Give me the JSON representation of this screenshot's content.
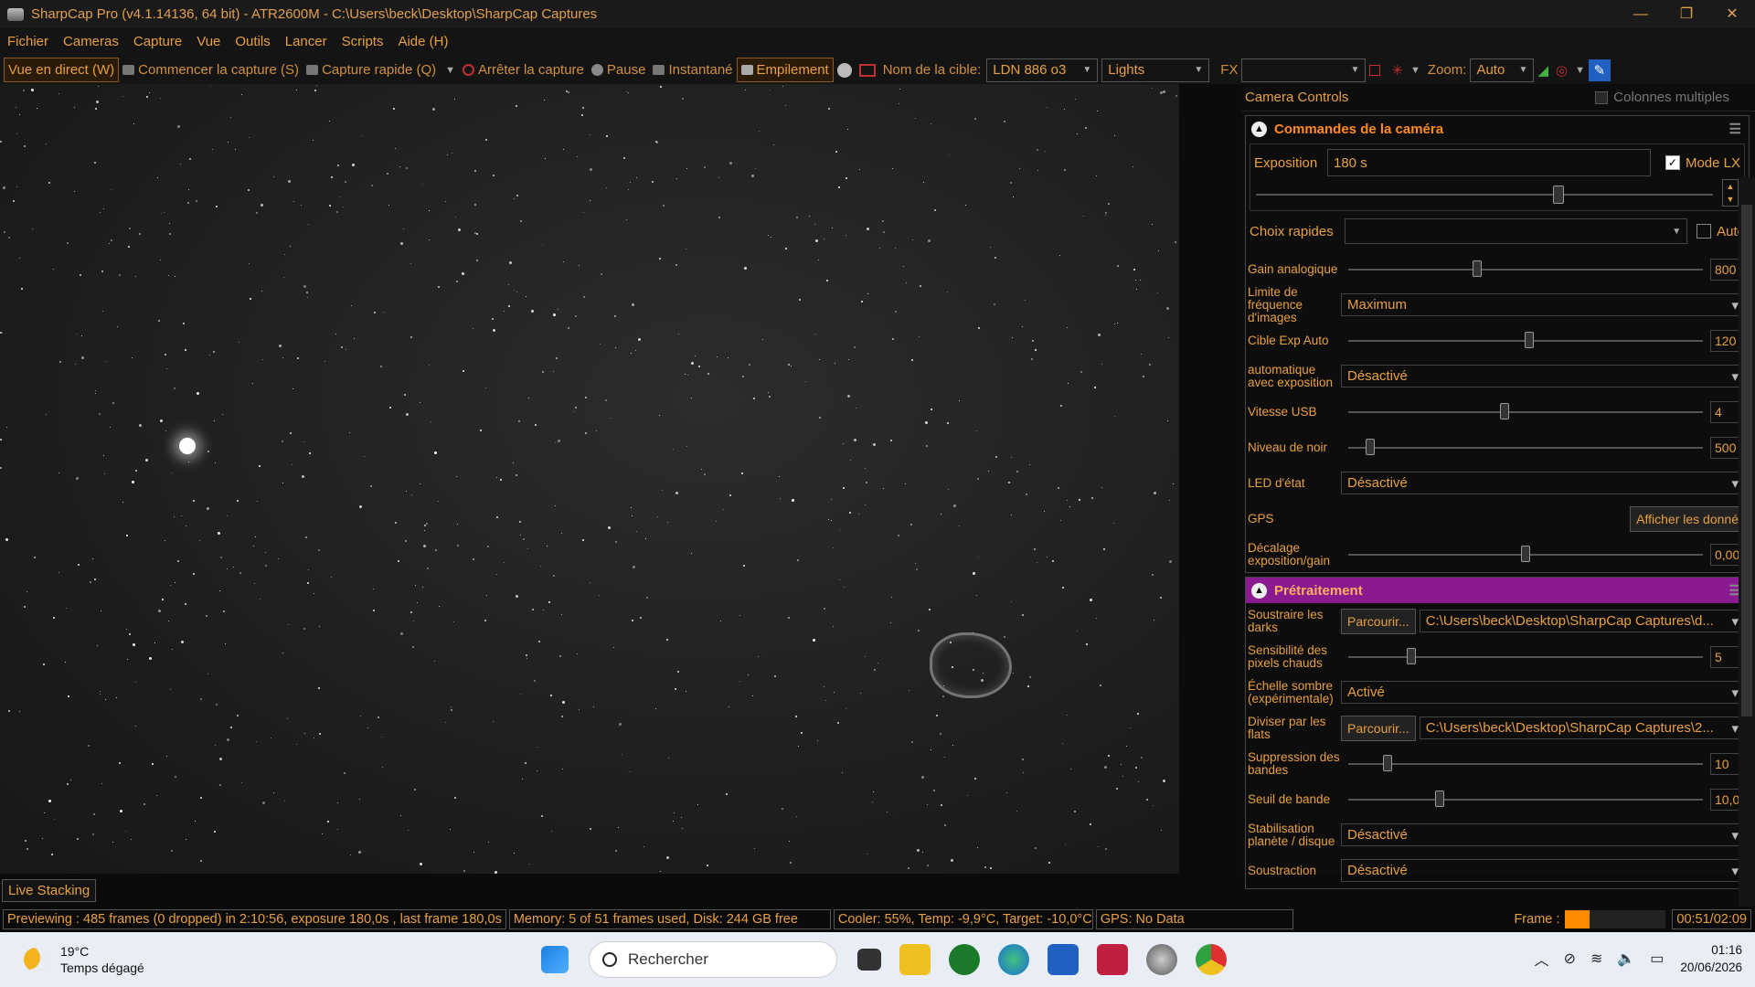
{
  "window": {
    "title": "SharpCap Pro (v4.1.14136, 64 bit) - ATR2600M - C:\\Users\\beck\\Desktop\\SharpCap Captures",
    "minimize": "—",
    "maximize": "❐",
    "close": "✕"
  },
  "menu": [
    "Fichier",
    "Cameras",
    "Capture",
    "Vue",
    "Outils",
    "Lancer",
    "Scripts",
    "Aide (H)"
  ],
  "toolbar": {
    "live_view": "Vue en direct (W)",
    "start_capture": "Commencer la capture (S)",
    "quick_capture": "Capture rapide (Q)",
    "stop_capture": "Arrêter la capture",
    "pause": "Pause",
    "snapshot": "Instantané",
    "stacking": "Empilement",
    "target_label": "Nom de la cible:",
    "target_value": "LDN 886 o3",
    "frame_type": "Lights",
    "fx_label": "FX",
    "fx_value": "",
    "zoom_label": "Zoom:",
    "zoom_value": "Auto"
  },
  "panel": {
    "title": "Camera Controls",
    "multi_columns": "Colonnes multiples",
    "camera_section": {
      "title": "Commandes de la caméra",
      "exposure_label": "Exposition",
      "exposure_value": "180 s",
      "lx_mode": "Mode LX",
      "quick_choice": "Choix rapides",
      "auto": "Auto",
      "rows": [
        {
          "label": "Gain analogique",
          "value": "800",
          "level": 0.36
        },
        {
          "label": "Limite de fréquence d'images",
          "select": "Maximum"
        },
        {
          "label": "Cible Exp Auto",
          "value": "120",
          "level": 0.51
        },
        {
          "label": "automatique avec exposition",
          "select": "Désactivé"
        },
        {
          "label": "Vitesse USB",
          "value": "4",
          "level": 0.44
        },
        {
          "label": "Niveau de noir",
          "value": "500",
          "level": 0.05
        },
        {
          "label": "LED d'état",
          "select": "Désactivé"
        },
        {
          "label": "GPS",
          "button": "Afficher les donné"
        },
        {
          "label": "Décalage exposition/gain",
          "value": "0,00",
          "level": 0.5
        }
      ]
    },
    "pre_section": {
      "title": "Prétraitement",
      "rows": [
        {
          "label": "Soustraire les darks",
          "button": "Parcourir...",
          "select": "C:\\Users\\beck\\Desktop\\SharpCap Captures\\d..."
        },
        {
          "label": "Sensibilité des pixels chauds",
          "value": "5",
          "level": 0.17
        },
        {
          "label": "Échelle sombre (expérimentale)",
          "select": "Activé"
        },
        {
          "label": "Diviser par les flats",
          "button": "Parcourir...",
          "select": "C:\\Users\\beck\\Desktop\\SharpCap Captures\\2..."
        },
        {
          "label": "Suppression des bandes",
          "value": "10",
          "level": 0.1
        },
        {
          "label": "Seuil de bande",
          "value": "10,0",
          "level": 0.25
        },
        {
          "label": "Stabilisation planète / disque",
          "select": "Désactivé"
        },
        {
          "label": "Soustraction",
          "select": "Désactivé"
        }
      ]
    }
  },
  "live_stacking_tab": "Live Stacking",
  "status": {
    "preview": "Previewing : 485 frames (0 dropped) in 2:10:56, exposure 180,0s , last frame 180,0s",
    "memory": "Memory: 5 of 51 frames used, Disk: 244 GB free",
    "cooler": "Cooler: 55%, Temp: -9,9°C, Target: -10,0°C",
    "gps": "GPS: No Data",
    "frame_label": "Frame :",
    "frame_progress": 0.24,
    "time": "00:51/02:09"
  },
  "taskbar": {
    "temp": "19°C",
    "weather": "Temps dégagé",
    "search": "Rechercher",
    "clock_time": "01:16",
    "clock_date": "20/06/2026"
  },
  "colors": {
    "accent": "#e8a040",
    "purple": "#8a1a90",
    "progress": "#ff8a00"
  }
}
